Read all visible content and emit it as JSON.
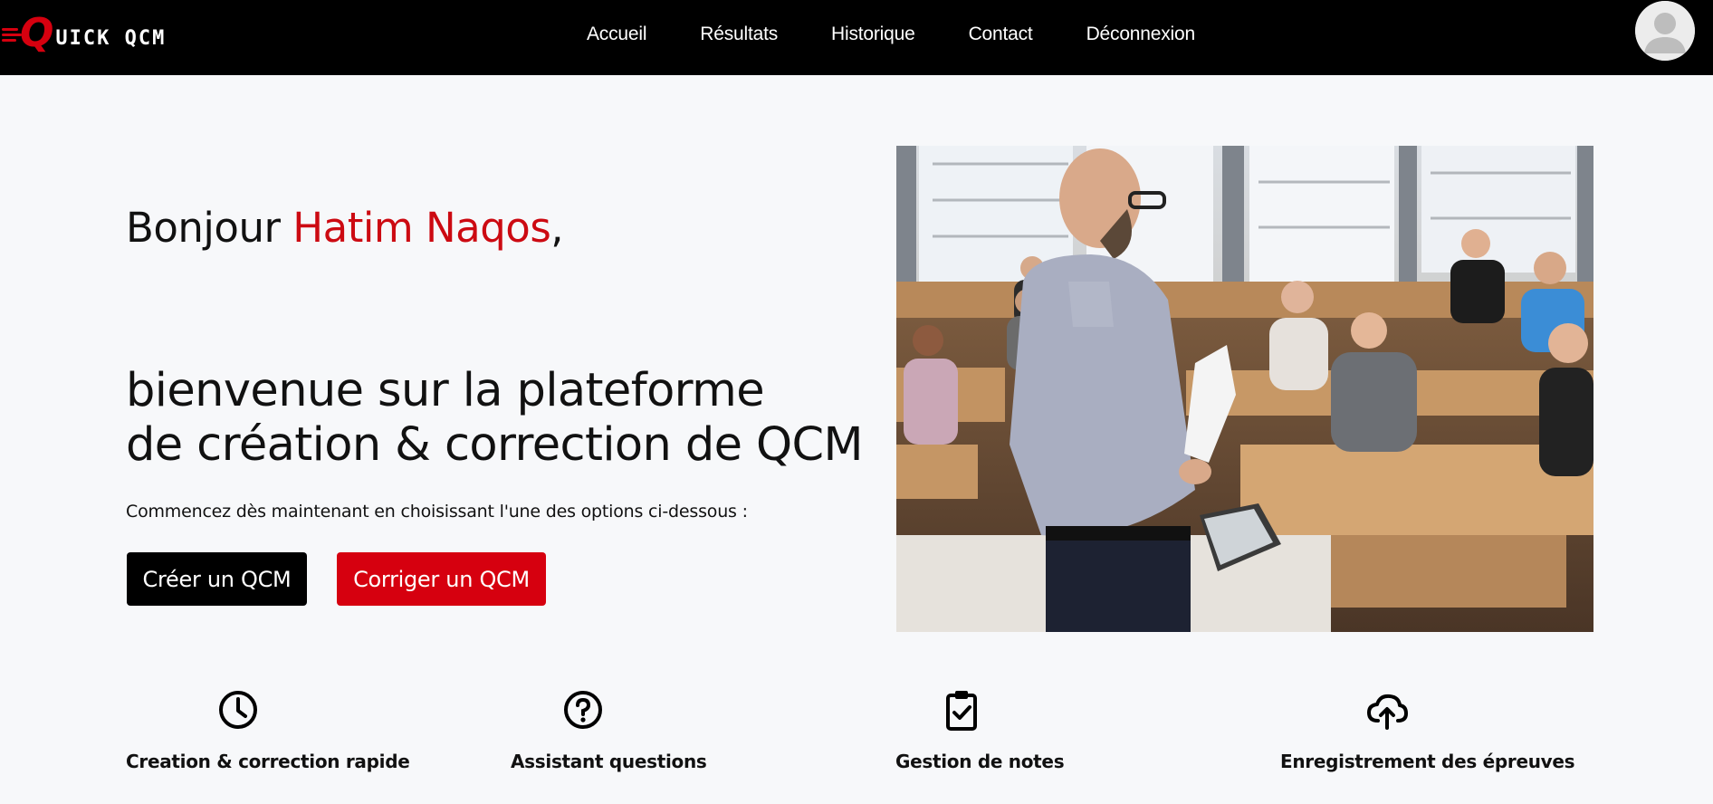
{
  "brand": {
    "logo_text": "QUICK QCM",
    "accent_color": "#d6000f"
  },
  "nav": {
    "links": [
      "Accueil",
      "Résultats",
      "Historique",
      "Contact",
      "Déconnexion"
    ]
  },
  "user": {
    "avatar_icon": "user-avatar-icon"
  },
  "hero": {
    "greeting": "Bonjour ",
    "user_name": "Hatim Naqos",
    "greeting_suffix": ",",
    "headline_line1": "bienvenue sur la plateforme",
    "headline_line2": "de création & correction de QCM",
    "subtext": "Commencez dès maintenant en choisissant l'une des options ci-dessous :",
    "create_button": "Créer un QCM",
    "correct_button": "Corriger un QCM"
  },
  "features": [
    {
      "icon": "clock-icon",
      "label": "Creation & correction rapide"
    },
    {
      "icon": "question-circle-icon",
      "label": "Assistant questions"
    },
    {
      "icon": "clipboard-check-icon",
      "label": "Gestion de notes"
    },
    {
      "icon": "cloud-upload-icon",
      "label": "Enregistrement des épreuves"
    }
  ]
}
